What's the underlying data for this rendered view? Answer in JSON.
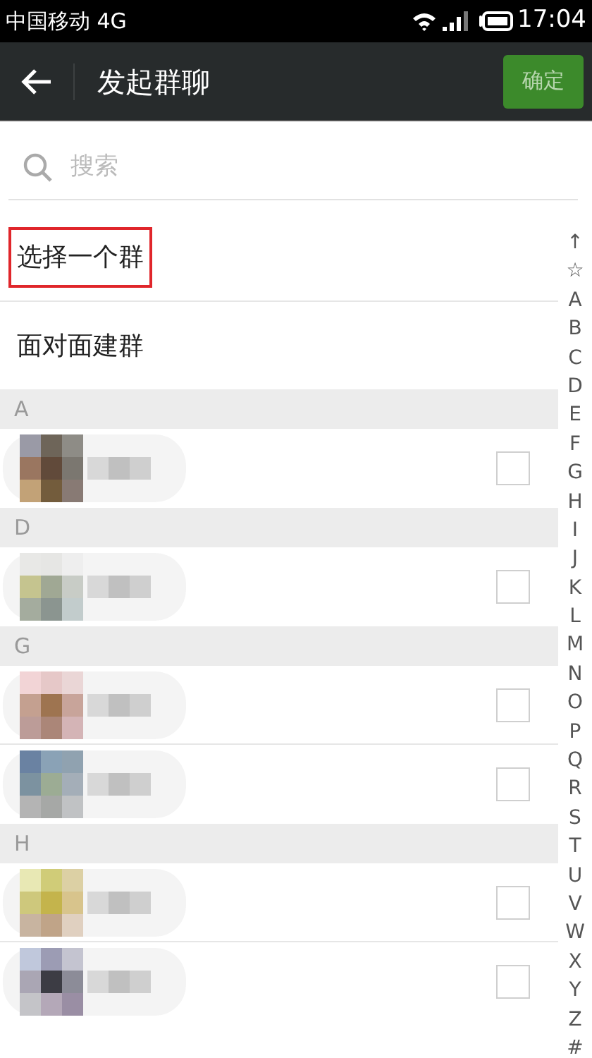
{
  "status_bar": {
    "carrier": "中国移动 4G",
    "time": "17:04"
  },
  "header": {
    "title": "发起群聊",
    "confirm_button": "确定"
  },
  "search": {
    "placeholder": "搜索"
  },
  "actions": [
    {
      "label": "选择一个群",
      "highlighted": true
    },
    {
      "label": "面对面建群",
      "highlighted": false
    }
  ],
  "sections": [
    {
      "letter": "A"
    },
    {
      "letter": "D"
    },
    {
      "letter": "G"
    },
    {
      "letter": "H"
    }
  ],
  "index_bar": [
    "↑",
    "☆",
    "A",
    "B",
    "C",
    "D",
    "E",
    "F",
    "G",
    "H",
    "I",
    "J",
    "K",
    "L",
    "M",
    "N",
    "O",
    "P",
    "Q",
    "R",
    "S",
    "T",
    "U",
    "V",
    "W",
    "X",
    "Y",
    "Z",
    "#"
  ]
}
